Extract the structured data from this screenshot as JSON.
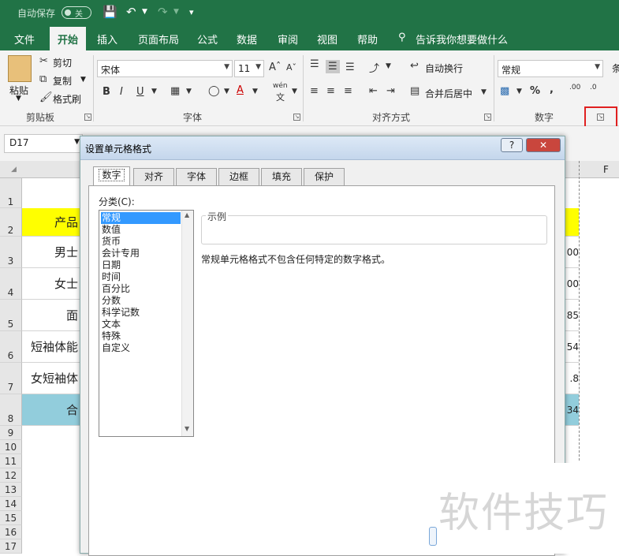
{
  "title_bar": {
    "autosave_label": "自动保存",
    "autosave_state": "关"
  },
  "tabs": [
    "文件",
    "开始",
    "插入",
    "页面布局",
    "公式",
    "数据",
    "审阅",
    "视图",
    "帮助"
  ],
  "tell_me": "告诉我你想要做什么",
  "ribbon": {
    "clipboard": {
      "paste": "粘贴",
      "cut": "剪切",
      "copy": "复制",
      "format_painter": "格式刷",
      "label": "剪贴板"
    },
    "font": {
      "name": "宋体",
      "size": "11",
      "bold": "B",
      "italic": "I",
      "underline": "U",
      "wen": "wén",
      "wen_char": "文",
      "label": "字体"
    },
    "alignment": {
      "wrap_text": "自动换行",
      "merge_center": "合并后居中",
      "label": "对齐方式"
    },
    "number": {
      "format": "常规",
      "percent": "%",
      "comma": ",",
      "dec_inc": ".00",
      "dec_dec": ".0",
      "label": "数字"
    },
    "partial_next": "条"
  },
  "name_box": "D17",
  "columns": {
    "last": "F"
  },
  "rows": [
    "1",
    "2",
    "3",
    "4",
    "5",
    "6",
    "7",
    "8",
    "9",
    "10",
    "11",
    "12",
    "13",
    "14",
    "15",
    "16",
    "17"
  ],
  "cells": {
    "b2": "产品",
    "b3": "男士",
    "b4": "女士",
    "b5": "面",
    "b6": "短袖体能",
    "b7": "女短袖体",
    "b8": "合",
    "e3": "00",
    "e4": "00",
    "e5": "85",
    "e6": "54",
    "e7": ".8",
    "e8": "34"
  },
  "dialog": {
    "title": "设置单元格格式",
    "help_btn": "?",
    "close_btn": "✕",
    "tabs": [
      "数字",
      "对齐",
      "字体",
      "边框",
      "填充",
      "保护"
    ],
    "category_label": "分类(C):",
    "categories": [
      "常规",
      "数值",
      "货币",
      "会计专用",
      "日期",
      "时间",
      "百分比",
      "分数",
      "科学记数",
      "文本",
      "特殊",
      "自定义"
    ],
    "sample_label": "示例",
    "description": "常规单元格格式不包含任何特定的数字格式。"
  },
  "watermark": "软件技巧",
  "colors": {
    "excel_green": "#217346",
    "selection": "#3399ff",
    "header_yellow": "#ffff00",
    "total_blue": "#92cddc",
    "highlight_red": "#e02020"
  }
}
